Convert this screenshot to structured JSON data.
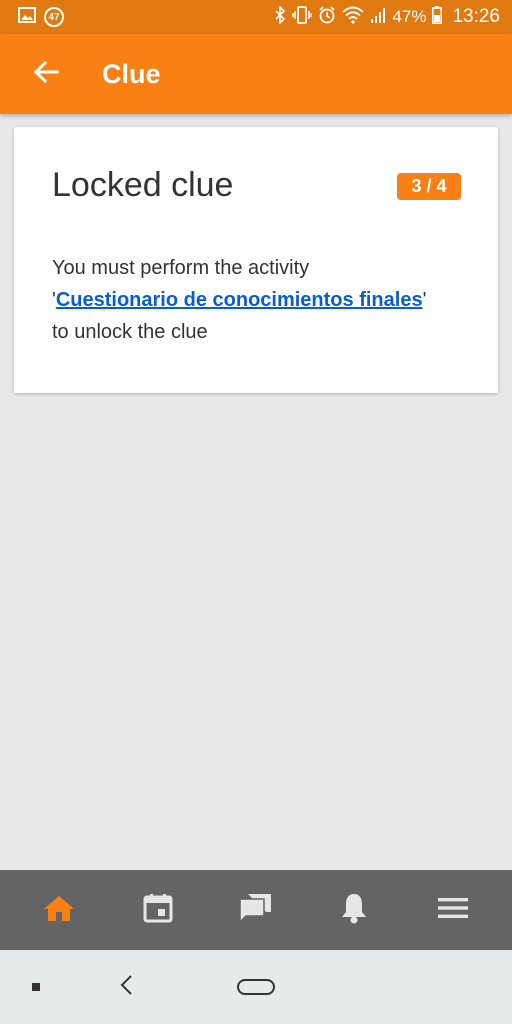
{
  "status_bar": {
    "notification_count": "47",
    "battery": "47%",
    "time": "13:26"
  },
  "app_bar": {
    "title": "Clue"
  },
  "card": {
    "title": "Locked clue",
    "progress": "3 / 4",
    "text_before": "You must perform the activity",
    "quote_open": "'",
    "activity_link": "Cuestionario de conocimientos finales",
    "quote_close": "'",
    "text_after": "to unlock the clue"
  },
  "bottom_nav": {
    "items": [
      {
        "icon": "home-icon",
        "active": true
      },
      {
        "icon": "calendar-icon"
      },
      {
        "icon": "messages-icon"
      },
      {
        "icon": "bell-icon"
      },
      {
        "icon": "menu-icon"
      }
    ],
    "active_color": "#f98012",
    "inactive_color": "#e6e6e6"
  },
  "colors": {
    "accent": "#f98012",
    "status_bar": "#e07a10",
    "link": "#0a5ec7"
  }
}
